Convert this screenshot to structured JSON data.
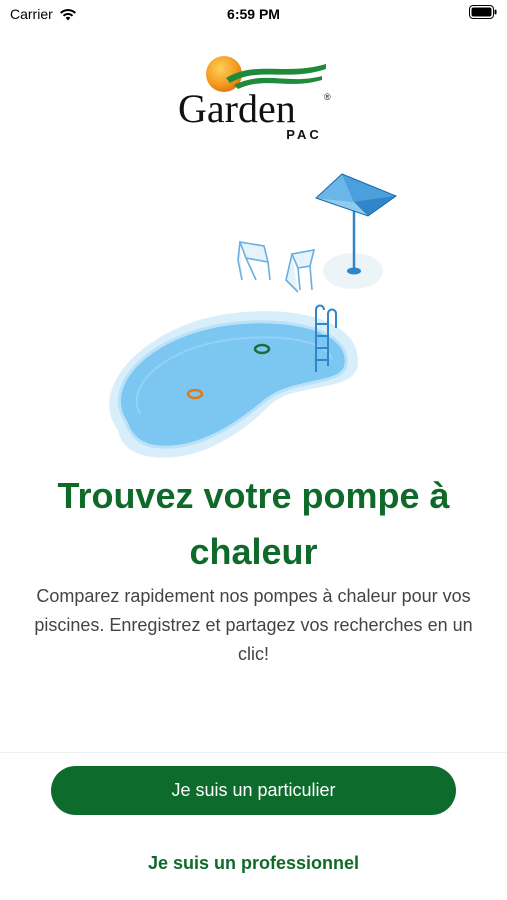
{
  "status_bar": {
    "carrier": "Carrier",
    "time": "6:59 PM",
    "icons": [
      "wifi-icon",
      "battery-icon"
    ]
  },
  "logo": {
    "brand": "Garden",
    "sub": "PAC",
    "registered": "®"
  },
  "hero": {
    "title": "Trouvez votre pompe à chaleur",
    "description": "Comparez rapidement nos pompes à chaleur pour vos piscines. Enregistrez et partagez vos recherches en un clic!"
  },
  "actions": {
    "primary_label": "Je suis un particulier",
    "secondary_label": "Je suis un professionnel"
  },
  "colors": {
    "brand_green": "#0f6a2a",
    "button_green": "#0d6b2c",
    "pool_blue": "#7cc6f2",
    "sun_orange": "#f39a1e"
  }
}
